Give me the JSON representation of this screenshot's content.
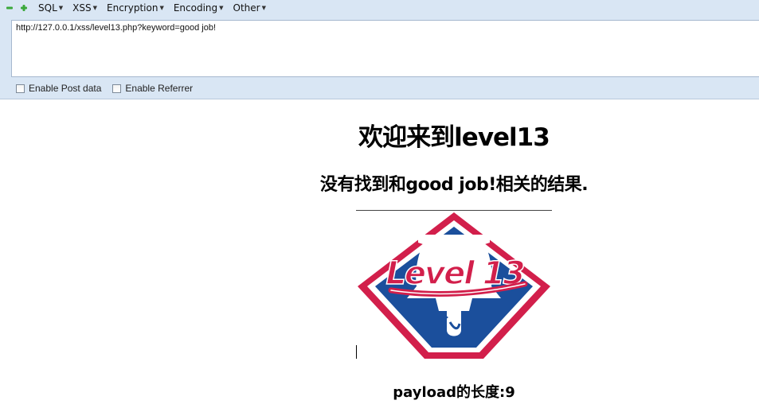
{
  "toolbar": {
    "menu": [
      {
        "label": "SQL"
      },
      {
        "label": "XSS"
      },
      {
        "label": "Encryption"
      },
      {
        "label": "Encoding"
      },
      {
        "label": "Other"
      }
    ],
    "url_value": "http://127.0.0.1/xss/level13.php?keyword=good job!",
    "enable_post_label": "Enable Post data",
    "enable_referrer_label": "Enable Referrer"
  },
  "page": {
    "title": "欢迎来到level13",
    "result": "没有找到和good job!相关的结果.",
    "payload_length": "payload的长度:9"
  },
  "logo": {
    "text": "Level 13",
    "colors": {
      "red": "#d21f4b",
      "blue": "#1b4f9c",
      "white": "#ffffff"
    }
  }
}
